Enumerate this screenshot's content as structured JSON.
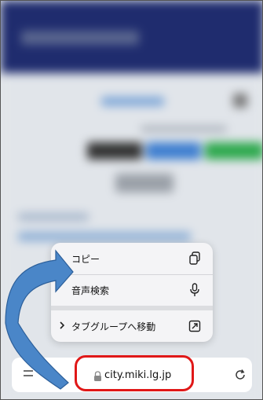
{
  "context_menu": {
    "items": [
      {
        "label": "コピー",
        "icon": "copy-icon"
      },
      {
        "label": "音声検索",
        "icon": "microphone-icon"
      },
      {
        "label": "タブグループへ移動",
        "icon": "move-to-tab-group-icon",
        "prefix_icon": "chevron-right-icon"
      }
    ]
  },
  "address_bar": {
    "url": "city.miki.lg.jp",
    "left_icon": "menu-icon",
    "right_icon": "reload-icon"
  },
  "annotations": {
    "highlight_color": "#e01818",
    "arrow_color": "#4a86c8"
  }
}
